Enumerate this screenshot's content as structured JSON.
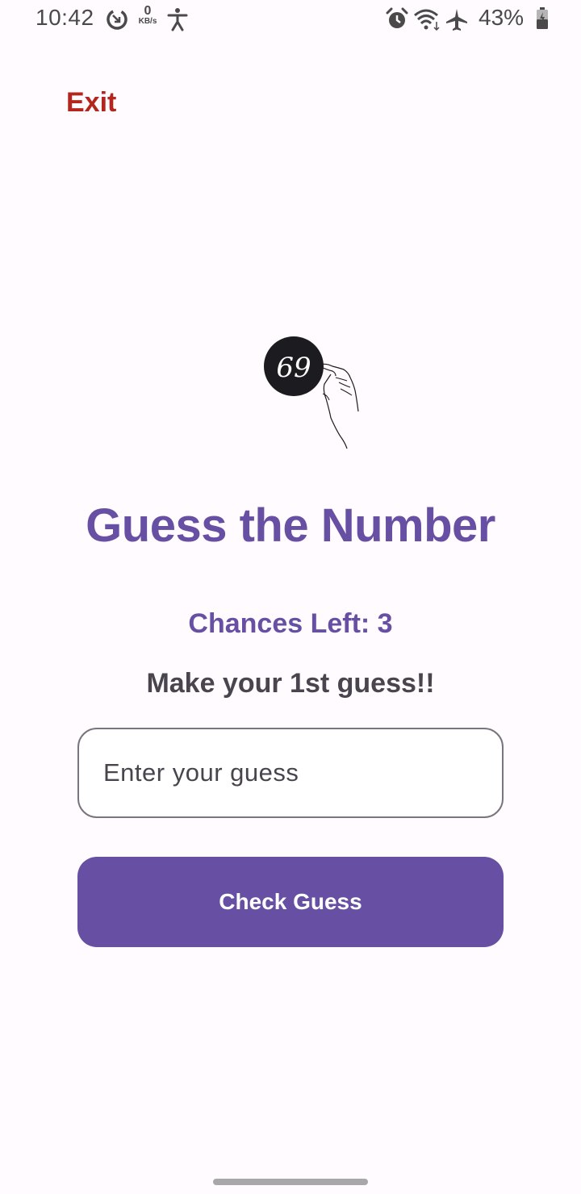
{
  "status_bar": {
    "time": "10:42",
    "net_speed_value": "0",
    "net_speed_unit": "KB/s",
    "battery": "43%",
    "icons": [
      "data-saver-icon",
      "net-speed-indicator",
      "accessibility-icon",
      "alarm-icon",
      "wifi-icon",
      "airplane-mode-icon",
      "battery-charging-icon"
    ]
  },
  "header": {
    "exit_label": "Exit"
  },
  "logo": {
    "number": "69",
    "icon": "hand-pointing-at-number-logo"
  },
  "main": {
    "title": "Guess the Number",
    "chances": "Chances Left: 3",
    "prompt": "Make your 1st guess!!",
    "input_placeholder": "Enter your guess",
    "input_value": "",
    "check_button_label": "Check Guess"
  },
  "colors": {
    "primary": "#6750a4",
    "exit": "#b3261e",
    "background": "#fffbfe",
    "secondary_text": "#49454f",
    "outline": "#79747e"
  }
}
